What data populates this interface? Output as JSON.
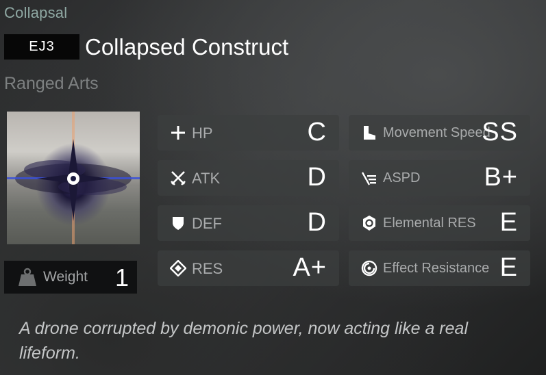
{
  "header": {
    "faction": "Collapsal",
    "code": "EJ3",
    "name": "Collapsed Construct",
    "attack_type": "Ranged Arts"
  },
  "weight": {
    "label": "Weight",
    "value": "1"
  },
  "stats": [
    {
      "label": "HP",
      "grade": "C",
      "icon": "plus-icon"
    },
    {
      "label": "Movement Speed",
      "grade": "SS",
      "icon": "boot-icon"
    },
    {
      "label": "ATK",
      "grade": "D",
      "icon": "crossed-swords-icon"
    },
    {
      "label": "ASPD",
      "grade": "B+",
      "icon": "speed-lines-icon"
    },
    {
      "label": "DEF",
      "grade": "D",
      "icon": "shield-icon"
    },
    {
      "label": "Elemental RES",
      "grade": "E",
      "icon": "elemental-shield-icon"
    },
    {
      "label": "RES",
      "grade": "A+",
      "icon": "diamond-icon"
    },
    {
      "label": "Effect Resistance",
      "grade": "E",
      "icon": "circle-swirl-icon"
    }
  ],
  "description": "A drone corrupted by demonic power, now acting like a real lifeform."
}
